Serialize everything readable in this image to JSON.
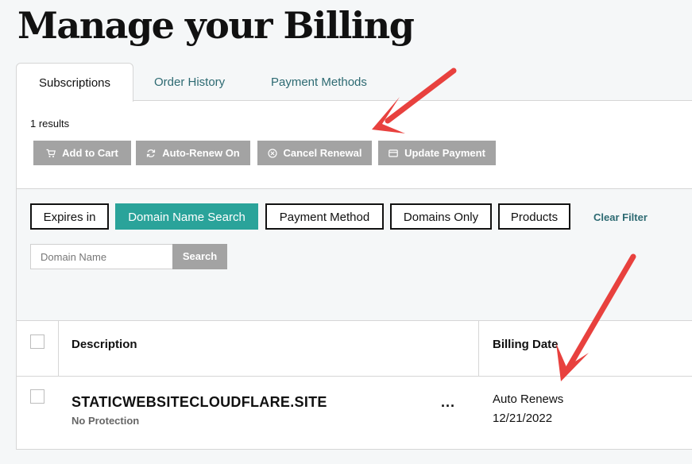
{
  "page": {
    "title": "Manage your Billing"
  },
  "tabs": [
    {
      "label": "Subscriptions",
      "active": true
    },
    {
      "label": "Order History",
      "active": false
    },
    {
      "label": "Payment Methods",
      "active": false
    }
  ],
  "results": "1 results",
  "actions": {
    "add_to_cart": "Add to Cart",
    "auto_renew": "Auto-Renew On",
    "cancel_renewal": "Cancel Renewal",
    "update_payment": "Update Payment"
  },
  "filters": {
    "expires_in": "Expires in",
    "domain_name_search": "Domain Name Search",
    "payment_method": "Payment Method",
    "domains_only": "Domains Only",
    "products": "Products",
    "clear_filter": "Clear Filter"
  },
  "search": {
    "placeholder": "Domain Name",
    "button": "Search"
  },
  "table": {
    "columns": [
      "Description",
      "Billing Date"
    ],
    "rows": [
      {
        "domain": "STATICWEBSITECLOUDFLARE.SITE",
        "protection": "No Protection",
        "more": "...",
        "renew_status": "Auto Renews",
        "billing_date": "12/21/2022"
      }
    ]
  },
  "colors": {
    "accent": "#2aa39a",
    "link": "#2d6a72",
    "button_gray": "#a3a3a3",
    "annotation_arrow": "#e8413e"
  },
  "icons": [
    "cart-icon",
    "refresh-icon",
    "cancel-circle-icon",
    "card-icon",
    "annotation-arrow"
  ]
}
